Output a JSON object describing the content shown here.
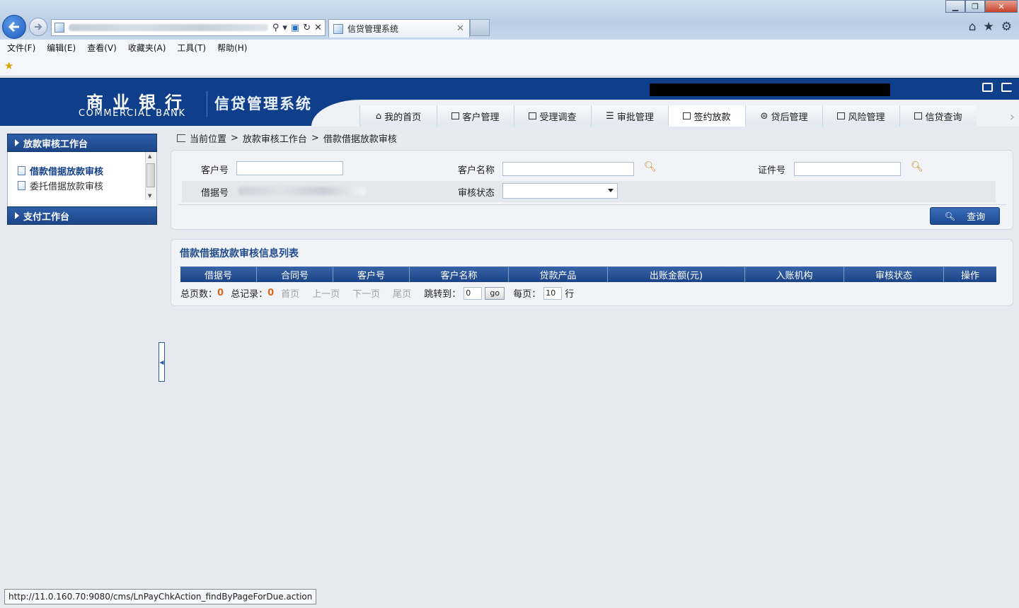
{
  "browser": {
    "tab_title": "信贷管理系统",
    "menu": [
      "文件(F)",
      "编辑(E)",
      "查看(V)",
      "收藏夹(A)",
      "工具(T)",
      "帮助(H)"
    ],
    "status_url": "http://11.0.160.70:9080/cms/LnPayChkAction_findByPageForDue.action"
  },
  "header": {
    "bank_cn": "商业银行",
    "bank_en": "COMMERCIAL BANK",
    "system_title": "信贷管理系统",
    "nav": [
      "我的首页",
      "客户管理",
      "受理调查",
      "审批管理",
      "签约放款",
      "贷后管理",
      "风险管理",
      "信贷查询"
    ],
    "active_nav": "签约放款"
  },
  "sidebar": {
    "group1": "放款审核工作台",
    "items": [
      "借款借据放款审核",
      "委托借据放款审核"
    ],
    "active_item": "借款借据放款审核",
    "group2": "支付工作台"
  },
  "breadcrumb": {
    "label": "当前位置",
    "sep": ">",
    "level1": "放款审核工作台",
    "level2": "借款借据放款审核"
  },
  "search": {
    "customer_no_label": "客户号",
    "customer_name_label": "客户名称",
    "id_no_label": "证件号",
    "receipt_no_label": "借据号",
    "status_label": "审核状态",
    "query_button": "查询"
  },
  "list": {
    "title": "借款借据放款审核信息列表",
    "columns": [
      "借据号",
      "合同号",
      "客户号",
      "客户名称",
      "贷款产品",
      "出账金额(元)",
      "入账机构",
      "审核状态",
      "操作"
    ],
    "rows": []
  },
  "pager": {
    "total_pages_label": "总页数：",
    "total_pages": "0",
    "total_records_label": "总记录：",
    "total_records": "0",
    "first": "首页",
    "prev": "上一页",
    "next": "下一页",
    "last": "尾页",
    "jump_label": "跳转到：",
    "jump_value": "0",
    "go": "go",
    "per_page_label": "每页：",
    "per_page": "10",
    "row_unit": "行"
  },
  "colors": {
    "header_blue": "#0f3f8a",
    "accent_orange": "#d2691e",
    "title_blue": "#1f4a8c"
  }
}
